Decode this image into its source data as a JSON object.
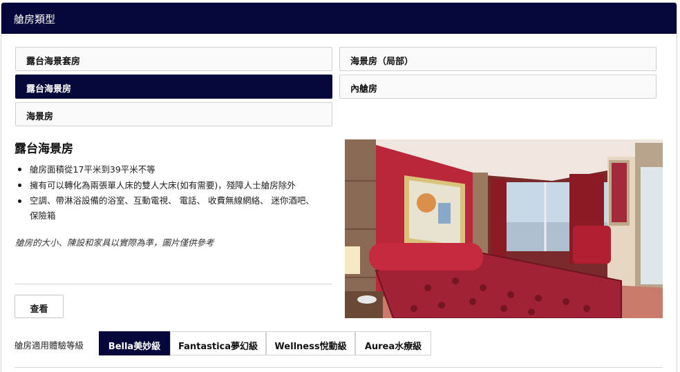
{
  "header": {
    "title": "艙房類型"
  },
  "room_types": [
    {
      "label": "露台海景套房",
      "active": false
    },
    {
      "label": "海景房（局部）",
      "active": false
    },
    {
      "label": "露台海景房",
      "active": true
    },
    {
      "label": "內艙房",
      "active": false
    },
    {
      "label": "海景房",
      "active": false
    }
  ],
  "detail": {
    "title": "露台海景房",
    "features": [
      "艙房面積從17平米到39平米不等",
      "擁有可以轉化為兩張單人床的雙人大床(如有需要)，殘障人士艙房除外",
      "空調、帶淋浴設備的浴室、互動電視、 電話、 收費無線網絡、 迷你酒吧、",
      "保險箱"
    ],
    "note": "艙房的大小、陳設和家具以實際為準，圖片僅供參考",
    "view_button": "查看"
  },
  "levels": {
    "label": "艙房適用體驗等級",
    "tabs": [
      {
        "label": "Bella美妙級",
        "active": true
      },
      {
        "label": "Fantastica夢幻級",
        "active": false
      },
      {
        "label": "Wellness悅動級",
        "active": false
      },
      {
        "label": "Aurea水療級",
        "active": false
      }
    ]
  },
  "colors": {
    "navy": "#05073a",
    "room_red": "#b8273a"
  }
}
